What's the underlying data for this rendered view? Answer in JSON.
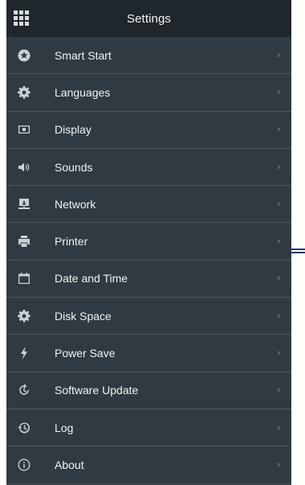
{
  "header": {
    "title": "Settings",
    "apps_icon": "apps-grid-icon"
  },
  "menu": [
    {
      "label": "Smart Start",
      "icon": "star-icon",
      "chevron": "›"
    },
    {
      "label": "Languages",
      "icon": "gear-icon",
      "chevron": "›"
    },
    {
      "label": "Display",
      "icon": "display-icon",
      "chevron": "›"
    },
    {
      "label": "Sounds",
      "icon": "speaker-icon",
      "chevron": "›"
    },
    {
      "label": "Network",
      "icon": "network-icon",
      "chevron": "›"
    },
    {
      "label": "Printer",
      "icon": "printer-icon",
      "chevron": "›"
    },
    {
      "label": "Date and Time",
      "icon": "calendar-icon",
      "chevron": "›"
    },
    {
      "label": "Disk Space",
      "icon": "gear-icon",
      "chevron": "›"
    },
    {
      "label": "Power Save",
      "icon": "lightning-icon",
      "chevron": "›"
    },
    {
      "label": "Software Update",
      "icon": "update-icon",
      "chevron": "›"
    },
    {
      "label": "Log",
      "icon": "history-icon",
      "chevron": "›"
    },
    {
      "label": "About",
      "icon": "info-icon",
      "chevron": "›"
    }
  ],
  "colors": {
    "background": "#2f3a42",
    "header": "#1f272d",
    "divider": "#4b565e",
    "text": "#f0f3f5"
  }
}
